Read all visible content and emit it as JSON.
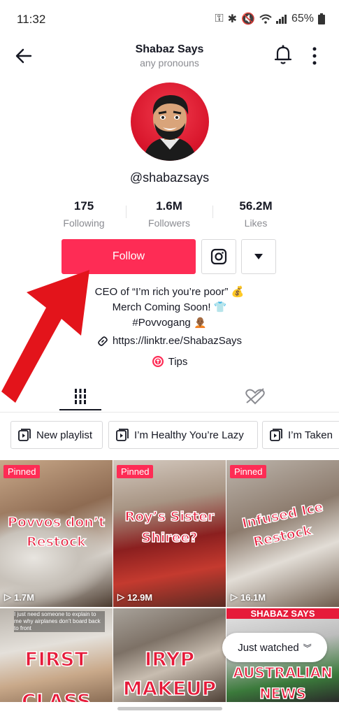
{
  "status_bar": {
    "time": "11:32",
    "battery": "65%"
  },
  "header": {
    "title": "Shabaz Says",
    "subtitle": "any pronouns"
  },
  "profile": {
    "handle": "@shabazsays",
    "stats": [
      {
        "value": "175",
        "label": "Following"
      },
      {
        "value": "1.6M",
        "label": "Followers"
      },
      {
        "value": "56.2M",
        "label": "Likes"
      }
    ],
    "follow_label": "Follow",
    "bio_lines": [
      "CEO of “I’m rich you’re poor” 💰",
      "Merch Coming Soon! 👕",
      "#Povvogang 🧑🏾‍🦲"
    ],
    "link": "https://linktr.ee/ShabazSays",
    "tips": "Tips"
  },
  "playlists": [
    {
      "label": "New playlist"
    },
    {
      "label": "I’m Healthy You’re Lazy"
    },
    {
      "label": "I’m Taken"
    }
  ],
  "videos": [
    {
      "pinned": "Pinned",
      "caption_line1": "Povvos don’t",
      "caption_line2": "Restock",
      "views": "1.7M"
    },
    {
      "pinned": "Pinned",
      "caption_line1": "Roy’s Sister",
      "caption_line2": "Shiree?",
      "views": "12.9M"
    },
    {
      "pinned": "Pinned",
      "caption_line1": "Infused Ice",
      "caption_line2": "Restock",
      "views": "16.1M"
    },
    {
      "caption_line1": "FIRST",
      "caption_line2": "CLASS",
      "overlay_text": "I just need someone to explain to me why airplanes don’t board back to front"
    },
    {
      "caption_line1": "IRYP",
      "caption_line2": "MAKEUP"
    },
    {
      "caption_line1": "AUSTRALIAN",
      "caption_line2": "NEWS",
      "banner": "SHABAZ SAYS"
    }
  ],
  "just_watched": "Just watched",
  "colors": {
    "accent": "#fe2c55",
    "arrow": "#e3141b",
    "text": "#161823",
    "muted": "#8a8b91"
  }
}
